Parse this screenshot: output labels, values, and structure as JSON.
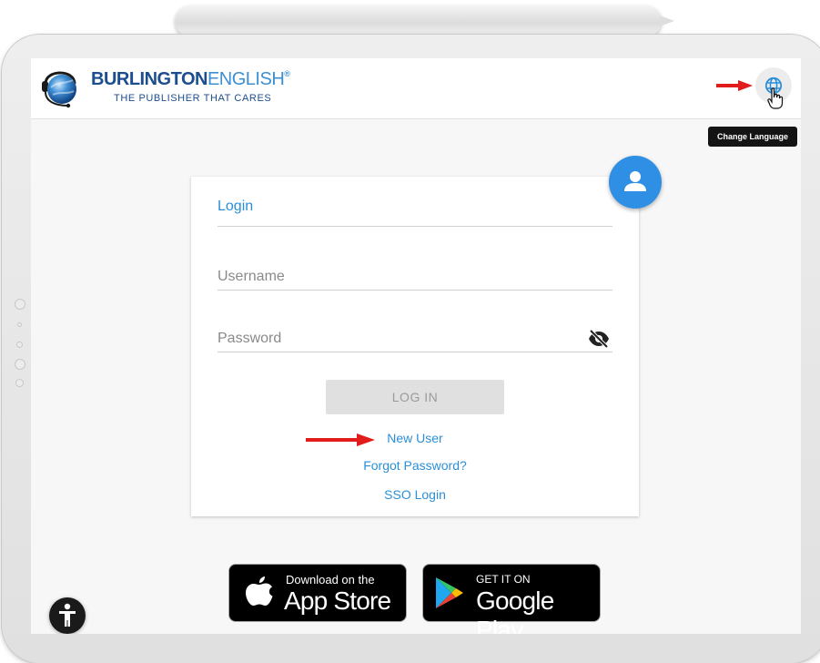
{
  "header": {
    "brand_main_dark": "BURLINGTON",
    "brand_main_light": "ENGLISH",
    "brand_reg": "®",
    "brand_sub": "THE PUBLISHER THAT CARES",
    "language_button_icon": "globe-icon",
    "tooltip": "Change Language"
  },
  "login": {
    "title": "Login",
    "username_placeholder": "Username",
    "password_placeholder": "Password",
    "toggle_icon": "eye-off-icon",
    "button_label": "LOG IN",
    "new_user": "New User",
    "forgot_password": "Forgot Password?",
    "sso_login": "SSO Login"
  },
  "stores": {
    "apple_small": "Download on the",
    "apple_big": "App Store",
    "google_small": "GET IT ON",
    "google_big": "Google Play"
  },
  "colors": {
    "accent": "#2b8fd8",
    "avatar": "#2e8fe5",
    "annotation_arrow": "#e21b1b"
  }
}
